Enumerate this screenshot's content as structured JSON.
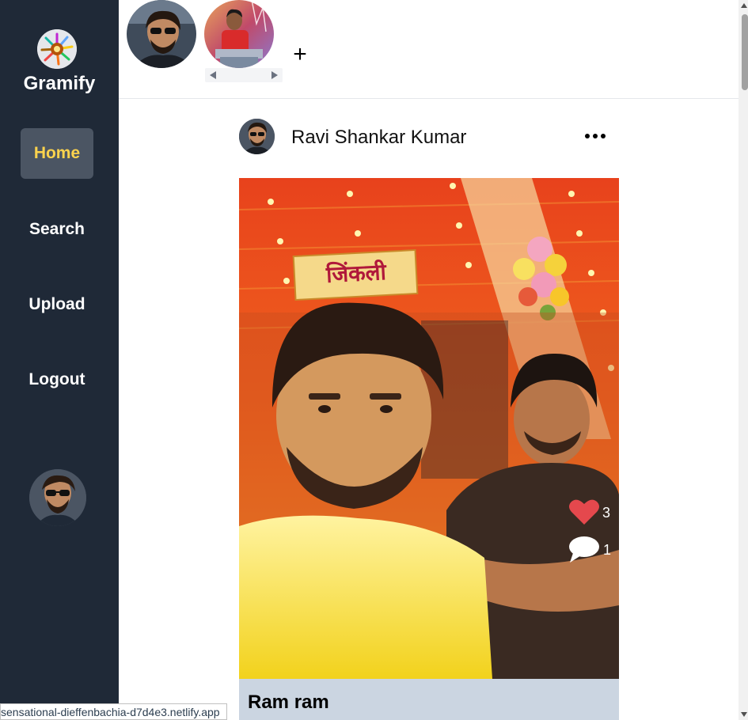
{
  "sidebar": {
    "brand": "Gramify",
    "logo_icon": "gramify-logo-icon",
    "items": [
      {
        "label": "Home",
        "active": true
      },
      {
        "label": "Search",
        "active": false
      },
      {
        "label": "Upload",
        "active": false
      },
      {
        "label": "Logout",
        "active": false
      }
    ],
    "profile_avatar": "profile-avatar"
  },
  "stories": {
    "add_symbol": "+"
  },
  "post": {
    "author": "Ravi Shankar Kumar",
    "likes": "3",
    "comments": "1",
    "caption": "Ram ram",
    "image_sign_text": "जिंकली"
  },
  "status_bar": {
    "url": "sensational-dieffenbachia-d7d4e3.netlify.app"
  },
  "colors": {
    "sidebar_bg": "#1f2937",
    "active_nav_bg": "#4b5563",
    "active_nav_text": "#fcd34d",
    "like_red": "#e5484d",
    "caption_bg": "#cbd5e1"
  }
}
